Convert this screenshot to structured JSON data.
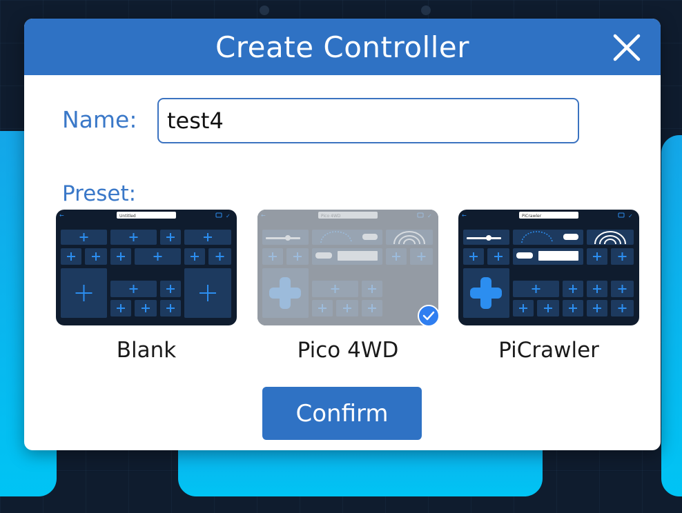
{
  "dialog": {
    "title": "Create Controller",
    "close_icon": "close-icon"
  },
  "form": {
    "name_label": "Name:",
    "name_value": "test4",
    "preset_label": "Preset:"
  },
  "presets": [
    {
      "name": "Blank",
      "thumb_title": "Untitled",
      "selected": false
    },
    {
      "name": "Pico 4WD",
      "thumb_title": "Pico 4WD",
      "selected": true
    },
    {
      "name": "PiCrawler",
      "thumb_title": "PiCrawler",
      "selected": false
    }
  ],
  "confirm_label": "Confirm",
  "colors": {
    "header": "#2f72c4",
    "accent_text": "#3a78c8",
    "confirm": "#2f72c4",
    "check": "#2f7ef0",
    "thumb_bg": "#0f1c2e",
    "thumb_cell": "#1d3a5f",
    "thumb_plus": "#2c8ef0"
  }
}
